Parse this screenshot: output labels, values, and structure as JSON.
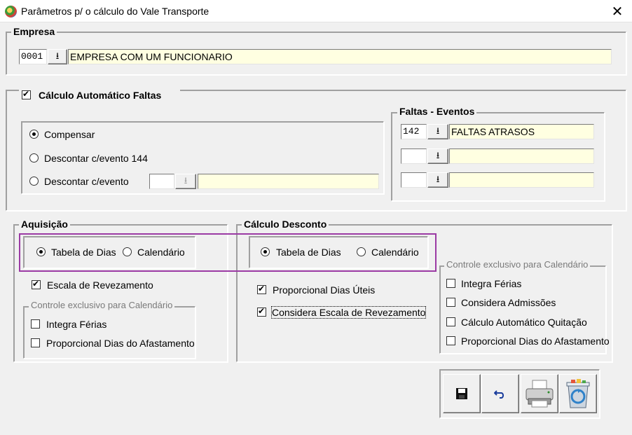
{
  "window": {
    "title": "Parâmetros p/ o cálculo do Vale Transporte",
    "close_icon": "close-icon"
  },
  "empresa": {
    "legend": "Empresa",
    "code": "0001",
    "name": "EMPRESA COM UM FUNCIONARIO"
  },
  "faltas": {
    "checkbox_label": "Cálculo Automático Faltas",
    "checked": true,
    "options": [
      "Compensar",
      "Descontar c/evento 144",
      "Descontar c/evento"
    ],
    "selected_option": "Compensar",
    "evento_code": "",
    "evento_desc": ""
  },
  "faltas_eventos": {
    "legend": "Faltas - Eventos",
    "rows": [
      {
        "code": "142",
        "desc": "FALTAS ATRASOS"
      },
      {
        "code": "",
        "desc": ""
      },
      {
        "code": "",
        "desc": ""
      }
    ]
  },
  "aquisicao": {
    "legend": "Aquisição",
    "options": [
      "Tabela de Dias",
      "Calendário"
    ],
    "selected": "Tabela de Dias",
    "escala_label": "Escala de Revezamento",
    "escala_checked": true,
    "controle_legend": "Controle exclusivo para Calendário",
    "controle_items": [
      "Integra Férias",
      "Proporcional Dias do Afastamento"
    ]
  },
  "calculo_desconto": {
    "legend": "Cálculo Desconto",
    "options": [
      "Tabela de Dias",
      "Calendário"
    ],
    "selected": "Tabela de Dias",
    "checks": [
      {
        "label": "Proporcional Dias Úteis",
        "checked": true
      },
      {
        "label": "Considera Escala de Revezamento",
        "checked": true
      }
    ],
    "controle_legend": "Controle exclusivo para Calendário",
    "controle_items": [
      "Integra Férias",
      "Considera Admissões",
      "Cálculo Automático Quitação",
      "Proporcional Dias do Afastamento"
    ]
  },
  "toolbar": {
    "buttons": [
      "save-icon",
      "undo-icon",
      "printer-icon",
      "recycle-bin-icon"
    ],
    "save_glyph": "💾",
    "undo_glyph": "↶"
  },
  "colors": {
    "highlight": "#9b3aa4",
    "input_yellow": "#ffffe1"
  }
}
